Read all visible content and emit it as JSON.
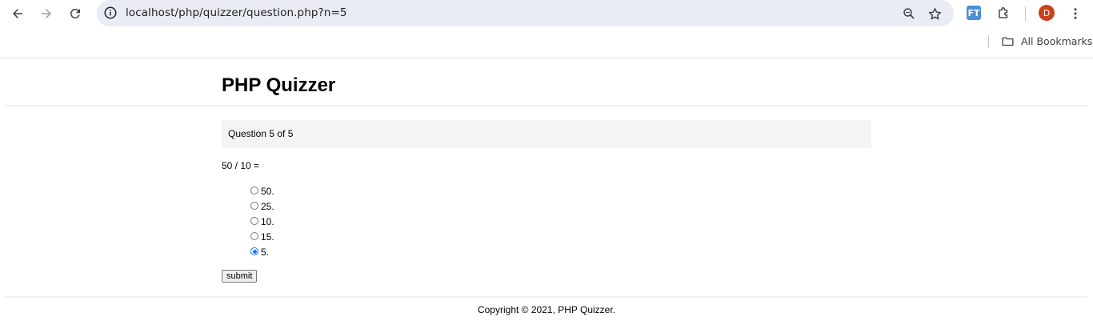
{
  "browser": {
    "url": "localhost/php/quizzer/question.php?n=5",
    "extension_label": "FT",
    "avatar_initial": "D",
    "bookmarks_label": "All Bookmarks"
  },
  "site": {
    "title": "PHP Quizzer"
  },
  "quiz": {
    "progress": "Question 5 of 5",
    "question": "50 / 10 =",
    "choices": [
      "50.",
      "25.",
      "10.",
      "15.",
      "5."
    ],
    "selected_index": 4,
    "submit_label": "submit"
  },
  "footer": {
    "text": "Copyright © 2021, PHP Quizzer."
  },
  "colors": {
    "accent": "#1a73e8",
    "avatar": "#c8431c",
    "omnibox": "#e9ecf4"
  }
}
